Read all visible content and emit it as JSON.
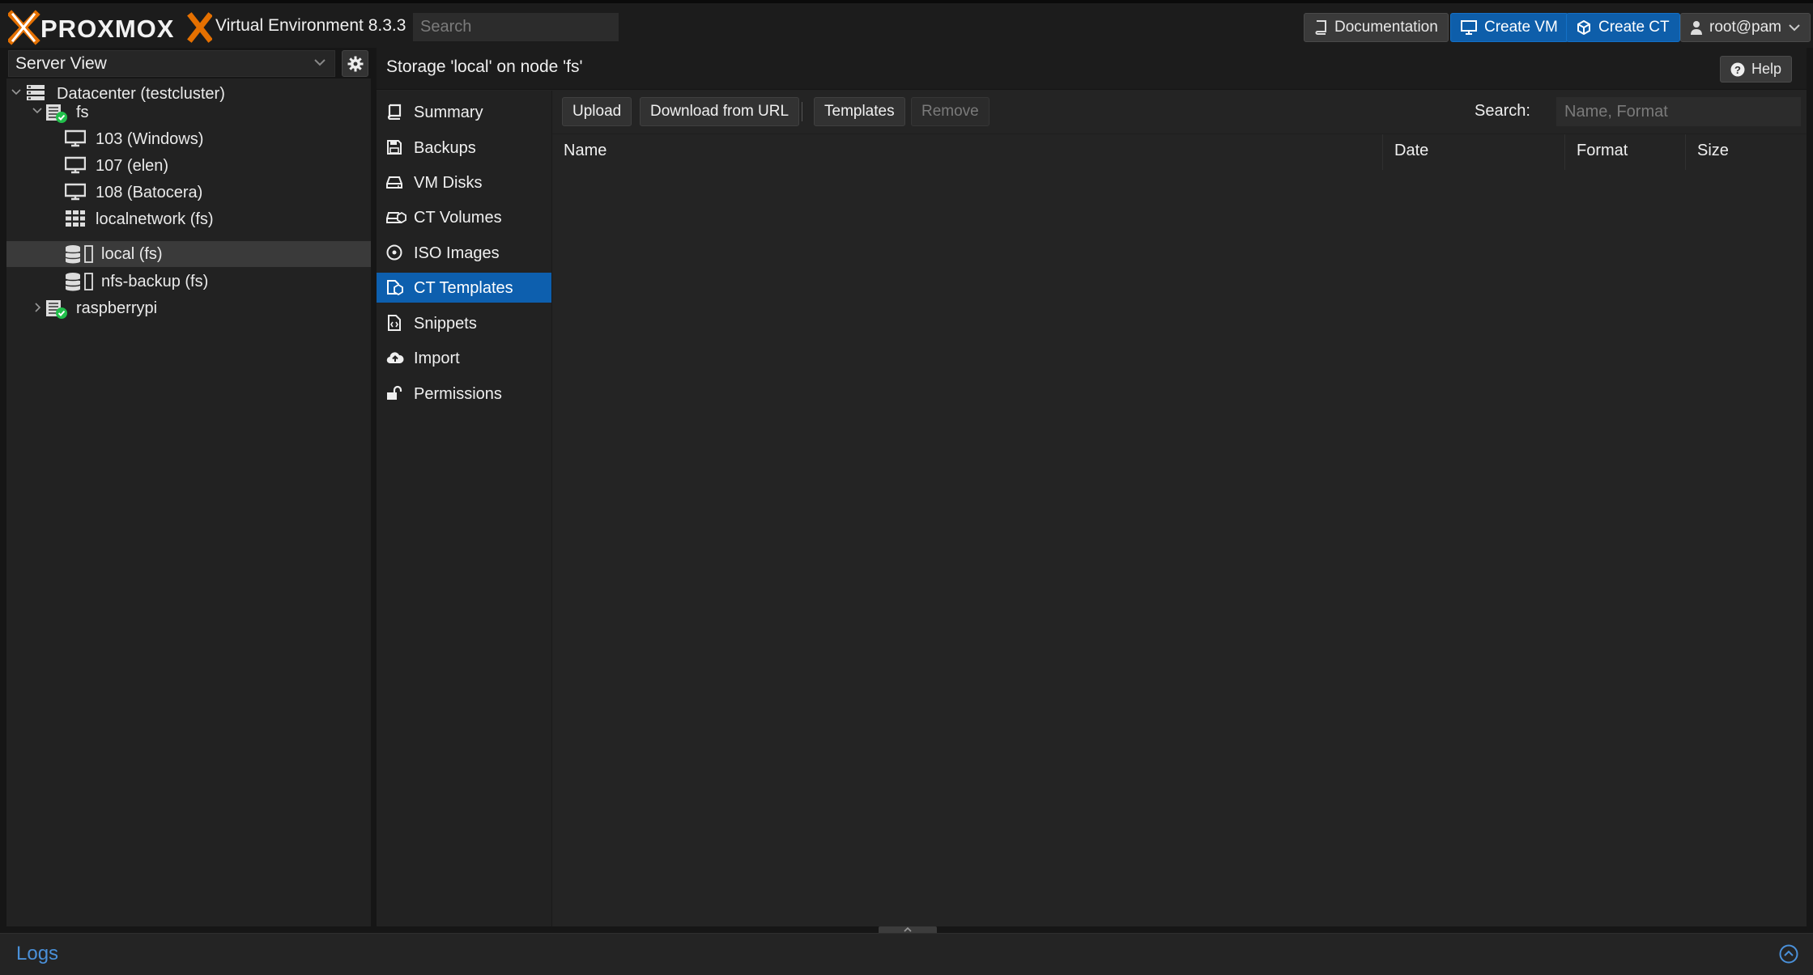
{
  "header": {
    "product": "PROXMOX",
    "version_text": "Virtual Environment 8.3.3",
    "search_placeholder": "Search",
    "documentation_label": "Documentation",
    "create_vm_label": "Create VM",
    "create_ct_label": "Create CT",
    "user_label": "root@pam"
  },
  "tree": {
    "view_label": "Server View",
    "nodes": [
      {
        "label": "Datacenter (testcluster)",
        "icon": "datacenter-icon"
      },
      {
        "label": "fs",
        "icon": "node-online-icon"
      },
      {
        "label": "103 (Windows)",
        "icon": "vm-monitor-icon"
      },
      {
        "label": "107 (elen)",
        "icon": "vm-monitor-icon"
      },
      {
        "label": "108 (Batocera)",
        "icon": "vm-monitor-icon"
      },
      {
        "label": "localnetwork (fs)",
        "icon": "sdn-grid-icon"
      },
      {
        "label": "local (fs)",
        "icon": "storage-icon",
        "selected": true
      },
      {
        "label": "nfs-backup (fs)",
        "icon": "storage-icon"
      },
      {
        "label": "raspberrypi",
        "icon": "node-online-icon"
      }
    ]
  },
  "main": {
    "title": "Storage 'local' on node 'fs'",
    "help_label": "Help",
    "nav": [
      {
        "label": "Summary",
        "icon": "book-icon"
      },
      {
        "label": "Backups",
        "icon": "floppy-icon"
      },
      {
        "label": "VM Disks",
        "icon": "hdd-icon"
      },
      {
        "label": "CT Volumes",
        "icon": "ct-volume-icon"
      },
      {
        "label": "ISO Images",
        "icon": "disc-icon"
      },
      {
        "label": "CT Templates",
        "icon": "ct-template-icon",
        "active": true
      },
      {
        "label": "Snippets",
        "icon": "snippet-file-icon"
      },
      {
        "label": "Import",
        "icon": "cloud-upload-icon"
      },
      {
        "label": "Permissions",
        "icon": "unlock-icon"
      }
    ],
    "toolbar": {
      "upload_label": "Upload",
      "download_url_label": "Download from URL",
      "templates_label": "Templates",
      "remove_label": "Remove",
      "search_label": "Search:",
      "search_placeholder": "Name, Format"
    },
    "columns": [
      "Name",
      "Date",
      "Format",
      "Size"
    ]
  },
  "logs": {
    "title": "Logs"
  },
  "colors": {
    "accent_blue": "#0d5fae",
    "logo_orange": "#e57000",
    "status_green": "#21bf4b"
  }
}
